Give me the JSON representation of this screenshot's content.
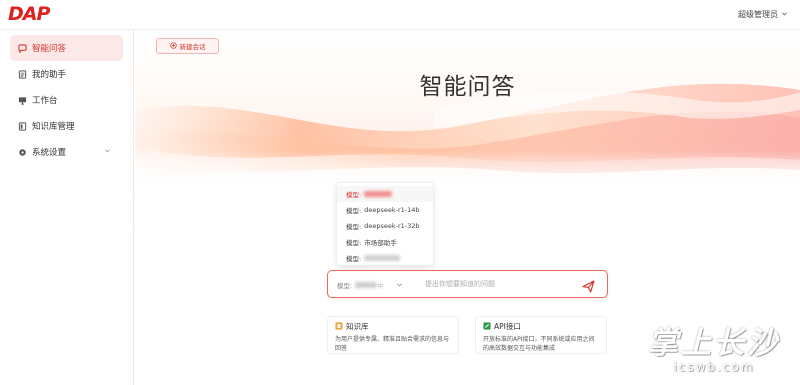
{
  "app": {
    "logo_text": "DAP",
    "user_label": "超级管理员"
  },
  "sidebar": {
    "items": [
      {
        "label": "智能问答",
        "icon": "chat-bubble-icon",
        "active": true
      },
      {
        "label": "我的助手",
        "icon": "assistant-doc-icon",
        "active": false
      },
      {
        "label": "工作台",
        "icon": "monitor-icon",
        "active": false
      },
      {
        "label": "知识库管理",
        "icon": "knowledge-base-icon",
        "active": false
      },
      {
        "label": "系统设置",
        "icon": "settings-gear-icon",
        "active": false,
        "expandable": true
      }
    ]
  },
  "main": {
    "new_chat_label": "新建会话",
    "title": "智能问答",
    "model_dropdown": {
      "options": [
        {
          "prefix": "模型:",
          "value": "",
          "blurred": true,
          "selected": true
        },
        {
          "prefix": "模型:",
          "value": "deepseek-r1-14b",
          "blurred": false,
          "selected": false
        },
        {
          "prefix": "模型:",
          "value": "deepseek-r1-32b",
          "blurred": false,
          "selected": false
        },
        {
          "prefix": "模型:",
          "value": "市场部助手",
          "blurred": false,
          "selected": false
        },
        {
          "prefix": "模型:",
          "value": "",
          "blurred": true,
          "selected": false
        }
      ]
    },
    "chat_input": {
      "model_prefix": "模型:",
      "model_suffix": "中",
      "placeholder": "提出你想要知道的问题"
    },
    "cards": [
      {
        "title": "知识库",
        "icon": "knowledge-card-icon",
        "description": "为用户提供专属、精准且贴合需求的信息与回答"
      },
      {
        "title": "API接口",
        "icon": "api-card-icon",
        "description": "开放标准的API接口，不同系统或应用之间的高效数据交互与功能集成"
      }
    ]
  },
  "watermark": {
    "main": "掌上长沙",
    "sub": "icswb.com"
  },
  "colors": {
    "accent": "#d9362f",
    "active_bg": "#fde8e8",
    "input_border": "#ea6a63"
  }
}
